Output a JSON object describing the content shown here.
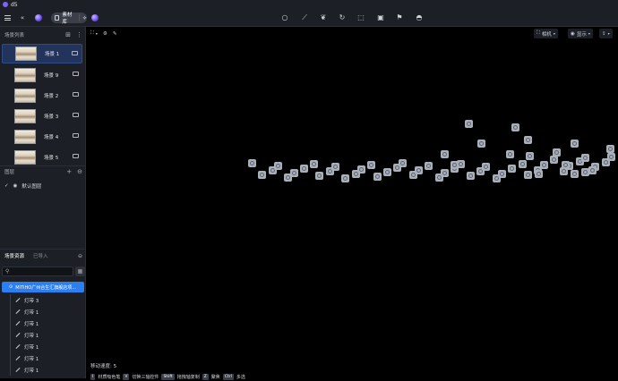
{
  "app": {
    "title": "d5"
  },
  "toolbar": {
    "material_library_label": "素材库",
    "tools": [
      "lightbulb-icon",
      "path-icon",
      "leaf-icon",
      "refresh-icon",
      "box-icon",
      "frame-icon",
      "flag-icon",
      "ufo-icon"
    ]
  },
  "scenes": {
    "header": "场景列表",
    "items": [
      {
        "label": "场景 1",
        "active": true
      },
      {
        "label": "场景 9",
        "active": false
      },
      {
        "label": "场景 2",
        "active": false
      },
      {
        "label": "场景 3",
        "active": false
      },
      {
        "label": "场景 4",
        "active": false
      },
      {
        "label": "场景 5",
        "active": false
      }
    ]
  },
  "layers": {
    "header": "图层",
    "default_layer": "默认图层"
  },
  "assets": {
    "tab_scene": "场景资源",
    "tab_imported": "已导入",
    "search_placeholder": "",
    "selected": "MITIHO广州合生汇旗舰店项...",
    "items": [
      "灯带 3",
      "灯带 1",
      "灯带 1",
      "灯带 1",
      "灯带 1",
      "灯带 1",
      "灯带 1"
    ]
  },
  "viewport": {
    "camera_label": "相机",
    "display_label": "显示",
    "move_speed": "移动速度: 5",
    "hints": [
      {
        "key": "I",
        "text": "材质吸色笔"
      },
      {
        "key": "V",
        "text": "切换三轴控件"
      },
      {
        "key": "Shift",
        "text": "拖拽轴复制"
      },
      {
        "key": "Z",
        "text": "聚焦"
      },
      {
        "key": "Ctrl",
        "text": "多选"
      }
    ]
  },
  "colors": {
    "accent": "#2b7ff0",
    "panel": "#1c1f25",
    "viewport": "#000000",
    "marker": "#aab0ba"
  }
}
